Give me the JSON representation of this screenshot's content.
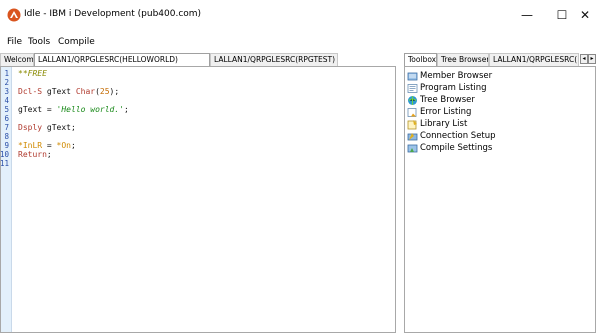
{
  "window": {
    "title": "Idle - IBM i Development (pub400.com)",
    "minimize_glyph": "—",
    "maximize_glyph": "☐",
    "close_glyph": "✕",
    "icon": "flame-app-icon"
  },
  "menu": {
    "file": "File",
    "tools": "Tools",
    "compile": "Compile"
  },
  "editor_tabs": [
    {
      "label": "Welcome"
    },
    {
      "label": "LALLAN1/QRPGLESRC(HELLOWORLD)"
    },
    {
      "label": "LALLAN1/QRPGLESRC(RPGTEST)"
    }
  ],
  "editor": {
    "line_numbers": [
      "1",
      "2",
      "3",
      "4",
      "5",
      "6",
      "7",
      "8",
      "9",
      "10",
      "11"
    ]
  },
  "right_tabs": [
    {
      "label": "Toolbox"
    },
    {
      "label": "Tree Browser"
    },
    {
      "label": "LALLAN1/QRPGLESRC("
    }
  ],
  "right_tab_arrows": {
    "left": "◂",
    "right": "▸"
  },
  "toolbox": {
    "items": [
      {
        "label": "Member Browser",
        "icon": "member-browser-icon"
      },
      {
        "label": "Program Listing",
        "icon": "program-listing-icon"
      },
      {
        "label": "Tree Browser",
        "icon": "tree-browser-icon"
      },
      {
        "label": "Error Listing",
        "icon": "error-listing-icon"
      },
      {
        "label": "Library List",
        "icon": "library-list-icon"
      },
      {
        "label": "Connection Setup",
        "icon": "connection-setup-icon"
      },
      {
        "label": "Compile Settings",
        "icon": "compile-settings-icon"
      }
    ]
  },
  "colors": {
    "gutter": "#e3f0fb",
    "keyword": "#b03a2e",
    "string": "#1a8a1a",
    "comment": "#8a8a00",
    "number": "#c46a00"
  }
}
